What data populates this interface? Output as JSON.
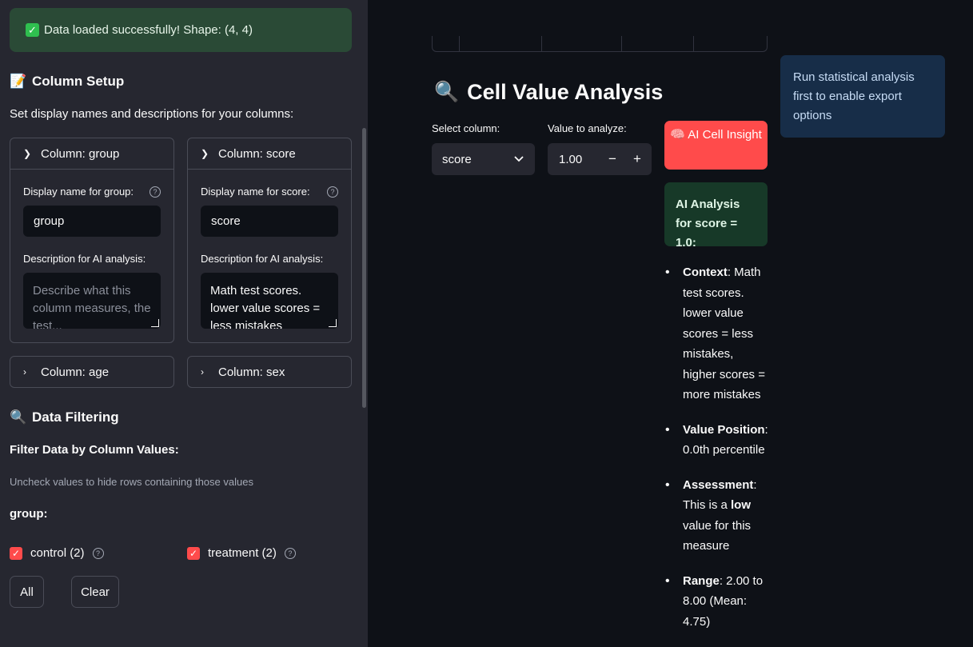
{
  "sidebar": {
    "success_text": "Data loaded successfully! Shape: (4, 4)",
    "column_setup": {
      "title": "Column Setup",
      "subtitle": "Set display names and descriptions for your columns:",
      "columns": [
        {
          "header": "Column: group",
          "display_label": "Display name for group:",
          "display_value": "group",
          "desc_label": "Description for AI analysis:",
          "desc_placeholder": "Describe what this column measures, the test..."
        },
        {
          "header": "Column: score",
          "display_label": "Display name for score:",
          "display_value": "score",
          "desc_label": "Description for AI analysis:",
          "desc_value": "Math test scores. lower value scores = less mistakes"
        }
      ],
      "collapsed": [
        "Column: age",
        "Column: sex"
      ]
    },
    "filtering": {
      "title": "Data Filtering",
      "subtitle": "Filter Data by Column Values:",
      "hint": "Uncheck values to hide rows containing those values",
      "group_label": "group:",
      "options": [
        "control (2)",
        "treatment (2)"
      ],
      "all_label": "All",
      "clear_label": "Clear"
    }
  },
  "main": {
    "section_title": "Cell Value Analysis",
    "select_label": "Select column:",
    "select_value": "score",
    "value_label": "Value to analyze:",
    "value": "1.00",
    "minus": "−",
    "plus": "+",
    "ai_button": "AI Cell Insight",
    "ai_box": "AI Analysis for score = 1.0:",
    "bullets": [
      {
        "key": "Context",
        "text": ": Math test scores. lower value scores = less mistakes, higher scores = more mistakes"
      },
      {
        "key": "Value Position",
        "text": ": 0.0th percentile"
      },
      {
        "key": "Assessment",
        "pre": ": This is a ",
        "bold": "low",
        "post": " value for this measure"
      },
      {
        "key": "Range",
        "text": ": 2.00 to 8.00 (Mean: 4.75)"
      }
    ],
    "export_info": "Run statistical analysis first to enable export options"
  },
  "icons": {
    "check": "check-icon",
    "memo": "memo-icon",
    "magnifier": "magnifier-icon",
    "brain": "brain-icon"
  }
}
